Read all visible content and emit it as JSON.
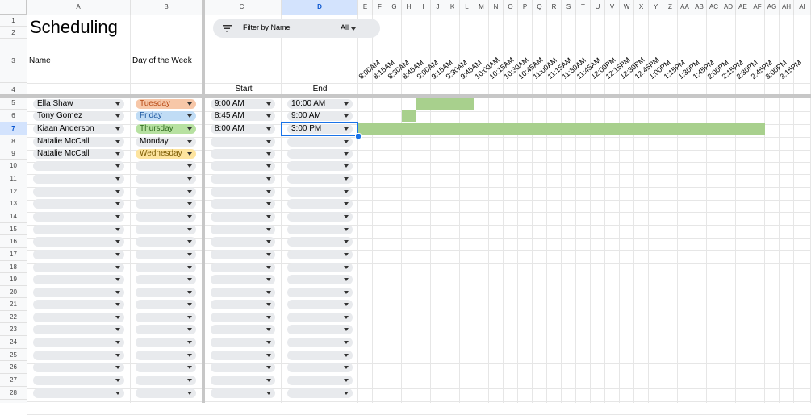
{
  "columns": [
    "A",
    "B",
    "C",
    "D",
    "E",
    "F",
    "G",
    "H",
    "I",
    "J",
    "K",
    "L",
    "M",
    "N",
    "O",
    "P",
    "Q",
    "R",
    "S",
    "T",
    "U",
    "V",
    "W",
    "X",
    "Y",
    "Z",
    "AA",
    "AB",
    "AC",
    "AD",
    "AE",
    "AF",
    "AG",
    "AH",
    "AI"
  ],
  "selected_column": "D",
  "row_numbers": [
    "1",
    "2",
    "3",
    "4",
    "5",
    "6",
    "7",
    "8",
    "9",
    "10",
    "11",
    "12",
    "13",
    "14",
    "15",
    "16",
    "17",
    "18",
    "19",
    "20",
    "21",
    "22",
    "23",
    "24",
    "25",
    "26",
    "27",
    "28"
  ],
  "selected_row": "7",
  "title": "Scheduling",
  "headers": {
    "name": "Name",
    "day": "Day of the Week",
    "start": "Start",
    "end": "End"
  },
  "filter": {
    "label": "Filter by Name",
    "value": "All"
  },
  "time_labels": [
    "8:00AM",
    "8:15AM",
    "8:30AM",
    "8:45AM",
    "9:00AM",
    "9:15AM",
    "9:30AM",
    "9:45AM",
    "10:00AM",
    "10:15AM",
    "10:30AM",
    "10:45AM",
    "11:00AM",
    "11:15AM",
    "11:30AM",
    "11:45AM",
    "12:00PM",
    "12:15PM",
    "12:30PM",
    "12:45PM",
    "1:00PM",
    "1:15PM",
    "1:30PM",
    "1:45PM",
    "2:00PM",
    "2:15PM",
    "2:30PM",
    "2:45PM",
    "3:00PM",
    "3:15PM"
  ],
  "entries": [
    {
      "name": "Ella Shaw",
      "day": "Tuesday",
      "start": "9:00 AM",
      "end": "10:00 AM"
    },
    {
      "name": "Tony Gomez",
      "day": "Friday",
      "start": "8:45 AM",
      "end": "9:00 AM"
    },
    {
      "name": "Kiaan Anderson",
      "day": "Thursday",
      "start": "8:00 AM",
      "end": "3:00 PM"
    },
    {
      "name": "Natalie McCall",
      "day": "Monday",
      "start": "",
      "end": ""
    },
    {
      "name": "Natalie McCall",
      "day": "Wednesday",
      "start": "",
      "end": ""
    }
  ],
  "day_colors": {
    "Tuesday": "#f7c7a8",
    "Friday": "#c0dcf5",
    "Thursday": "#b7e1a1",
    "Monday": "#e8eaed",
    "Wednesday": "#fde49f"
  },
  "chip_color": "#e8eaed",
  "bar_color": "#a8d08d",
  "accent": "#1a73e8"
}
